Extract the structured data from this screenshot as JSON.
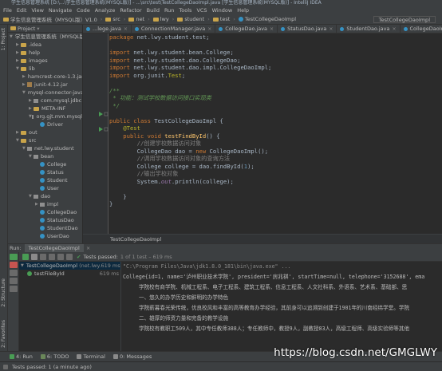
{
  "window": {
    "title": "学生信息管理系统 [D:\\...\\学生信息管理系统(MYSQL版)] - ...\\src\\test\\TestCollegeDaoImpl.java [学生信息管理系统(MYSQL版)] - IntelliJ IDEA"
  },
  "menu": [
    "File",
    "Edit",
    "View",
    "Navigate",
    "Code",
    "Analyze",
    "Refactor",
    "Build",
    "Run",
    "Tools",
    "VCS",
    "Window",
    "Help"
  ],
  "nav": {
    "crumbs": [
      "学生信息管理系统（MYSQL版）V1.0",
      "src",
      "net",
      "lwy",
      "student",
      "test",
      "TestCollegeDaoImpl"
    ],
    "run_config": "TestCollegeDaoImpl"
  },
  "left_tool": {
    "project_label": "1: Project",
    "structure_label": "2: Structure",
    "favorites_label": "2: Favorites"
  },
  "project": {
    "header": "Project",
    "items": [
      {
        "label": "学生信息管理系统（MYSQL版）",
        "depth": 0,
        "icon": "folder",
        "arrow": "▼"
      },
      {
        "label": ".idea",
        "depth": 1,
        "icon": "folder",
        "arrow": "▶"
      },
      {
        "label": "help",
        "depth": 1,
        "icon": "folder",
        "arrow": "▶"
      },
      {
        "label": "images",
        "depth": 1,
        "icon": "folder",
        "arrow": "▶"
      },
      {
        "label": "lib",
        "depth": 1,
        "icon": "folder",
        "arrow": "▼"
      },
      {
        "label": "hamcrest-core-1.3.jar",
        "depth": 2,
        "icon": "jar",
        "arrow": "▶"
      },
      {
        "label": "junit-4.12.jar",
        "depth": 2,
        "icon": "jar",
        "arrow": "▶"
      },
      {
        "label": "mysql-connector-java",
        "depth": 2,
        "icon": "jar",
        "arrow": "▼"
      },
      {
        "label": "com.mysql.jdbc",
        "depth": 3,
        "icon": "package",
        "arrow": "▶"
      },
      {
        "label": "META-INF",
        "depth": 3,
        "icon": "folder",
        "arrow": "▶"
      },
      {
        "label": "org.gjt.mm.mysql",
        "depth": 3,
        "icon": "package",
        "arrow": "▼"
      },
      {
        "label": "Driver",
        "depth": 4,
        "icon": "class",
        "arrow": ""
      },
      {
        "label": "out",
        "depth": 1,
        "icon": "folder",
        "arrow": "▶"
      },
      {
        "label": "src",
        "depth": 1,
        "icon": "folder",
        "arrow": "▼"
      },
      {
        "label": "net.lwy.student",
        "depth": 2,
        "icon": "package",
        "arrow": "▼"
      },
      {
        "label": "bean",
        "depth": 3,
        "icon": "package",
        "arrow": "▼"
      },
      {
        "label": "College",
        "depth": 4,
        "icon": "class",
        "arrow": ""
      },
      {
        "label": "Status",
        "depth": 4,
        "icon": "class",
        "arrow": ""
      },
      {
        "label": "Student",
        "depth": 4,
        "icon": "class",
        "arrow": ""
      },
      {
        "label": "User",
        "depth": 4,
        "icon": "class",
        "arrow": ""
      },
      {
        "label": "dao",
        "depth": 3,
        "icon": "package",
        "arrow": "▼"
      },
      {
        "label": "impl",
        "depth": 4,
        "icon": "package",
        "arrow": "▶"
      },
      {
        "label": "CollegeDao",
        "depth": 4,
        "icon": "class",
        "arrow": ""
      },
      {
        "label": "StatusDao",
        "depth": 4,
        "icon": "class",
        "arrow": ""
      },
      {
        "label": "StudentDao",
        "depth": 4,
        "icon": "class",
        "arrow": ""
      },
      {
        "label": "UserDao",
        "depth": 4,
        "icon": "class",
        "arrow": ""
      }
    ]
  },
  "tabs": [
    {
      "label": "...lege.java",
      "active": false
    },
    {
      "label": "ConnectionManager.java",
      "active": false
    },
    {
      "label": "CollegeDao.java",
      "active": false
    },
    {
      "label": "StatusDao.java",
      "active": false
    },
    {
      "label": "StudentDao.java",
      "active": false
    },
    {
      "label": "CollegeDaoImpl.java",
      "active": false
    },
    {
      "label": "TestCollegeDaoImpl",
      "active": true
    }
  ],
  "code": [
    [
      {
        "t": "package ",
        "c": "kw"
      },
      {
        "t": "net.lwy.student.test;",
        "c": "id"
      }
    ],
    [],
    [
      {
        "t": "import ",
        "c": "kw"
      },
      {
        "t": "net.lwy.student.bean.College;",
        "c": "id"
      }
    ],
    [
      {
        "t": "import ",
        "c": "kw"
      },
      {
        "t": "net.lwy.student.dao.CollegeDao;",
        "c": "id"
      }
    ],
    [
      {
        "t": "import ",
        "c": "kw"
      },
      {
        "t": "net.lwy.student.dao.impl.CollegeDaoImpl;",
        "c": "id"
      }
    ],
    [
      {
        "t": "import ",
        "c": "kw"
      },
      {
        "t": "org.junit.",
        "c": "id"
      },
      {
        "t": "Test",
        "c": "ann"
      },
      {
        "t": ";",
        "c": "id"
      }
    ],
    [],
    [
      {
        "t": "/**",
        "c": "cmt"
      }
    ],
    [
      {
        "t": " * 功能：测试学校数据访问接口实现类",
        "c": "cmt"
      }
    ],
    [
      {
        "t": " */",
        "c": "cmt"
      }
    ],
    [],
    [
      {
        "t": "public class ",
        "c": "kw"
      },
      {
        "t": "TestCollegeDaoImpl ",
        "c": "id"
      },
      {
        "t": "{",
        "c": "id"
      }
    ],
    [
      {
        "t": "    @Test",
        "c": "ann"
      }
    ],
    [
      {
        "t": "    public void ",
        "c": "kw"
      },
      {
        "t": "testFindById",
        "c": "fn"
      },
      {
        "t": "() {",
        "c": "id"
      }
    ],
    [
      {
        "t": "        //创建学校数据访问对象",
        "c": "lc"
      }
    ],
    [
      {
        "t": "        CollegeDao dao = ",
        "c": "id"
      },
      {
        "t": "new ",
        "c": "kw"
      },
      {
        "t": "CollegeDaoImpl();",
        "c": "id"
      }
    ],
    [
      {
        "t": "        //调用学校数据访问对象的查询方法",
        "c": "lc"
      }
    ],
    [
      {
        "t": "        College college = dao.findById(",
        "c": "id"
      },
      {
        "t": "1",
        "c": "num"
      },
      {
        "t": ");",
        "c": "id"
      }
    ],
    [
      {
        "t": "        //输出学校对象",
        "c": "lc"
      }
    ],
    [
      {
        "t": "        System.",
        "c": "id"
      },
      {
        "t": "out",
        "c": "fld"
      },
      {
        "t": ".println(college);",
        "c": "id"
      }
    ],
    [],
    [
      {
        "t": "    }",
        "c": "id"
      }
    ],
    [
      {
        "t": "}",
        "c": "id"
      }
    ]
  ],
  "editor_footer": "TestCollegeDaoImpl",
  "run": {
    "label": "Run:",
    "tab_title": "TestCollegeDaoImpl",
    "status_prefix": "Tests passed:",
    "status_detail": "1 of 1 test – 619 ms",
    "tree": [
      {
        "label": "TestCollegeDaoImpl",
        "detail": "(net.lwy.",
        "time": "619 ms",
        "sel": true,
        "depth": 0
      },
      {
        "label": "testFileById",
        "detail": "",
        "time": "619 ms",
        "sel": false,
        "depth": 1
      }
    ],
    "console": [
      "\"C:\\Program Files\\Java\\jdk1.8.0_181\\bin\\java.exe\" ...",
      "College{id=1, name='泸州职业技术学院', president='房兆祺', startTime=null, telephone='3152688', ema",
      "学院校有商学院、机械工程系、电子工程系、建筑工程系、信息工程系、人文社科系、外语系、艺术系、基础部、思",
      "一、悠久的办学历史和鲜明的办学特色",
      "学院薪暮春光荣传统，优良校风和丰富的高等教育办学经验，其前身可以追溯到创建于1901年的川南经纬学堂。学院",
      "二、雄厚的师资力量和完备的教学设施",
      "学院校有教职工509人，其中专任教师388人；专任教师中，教授9人，副教授83人，高级工程师、高级实验师等其他"
    ]
  },
  "bottom_tabs": [
    "4: Run",
    "6: TODO",
    "Terminal",
    "0: Messages"
  ],
  "statusbar": "Tests passed: 1 (a minute ago)",
  "watermark": "https://blog.csdn.net/GMGLWY"
}
